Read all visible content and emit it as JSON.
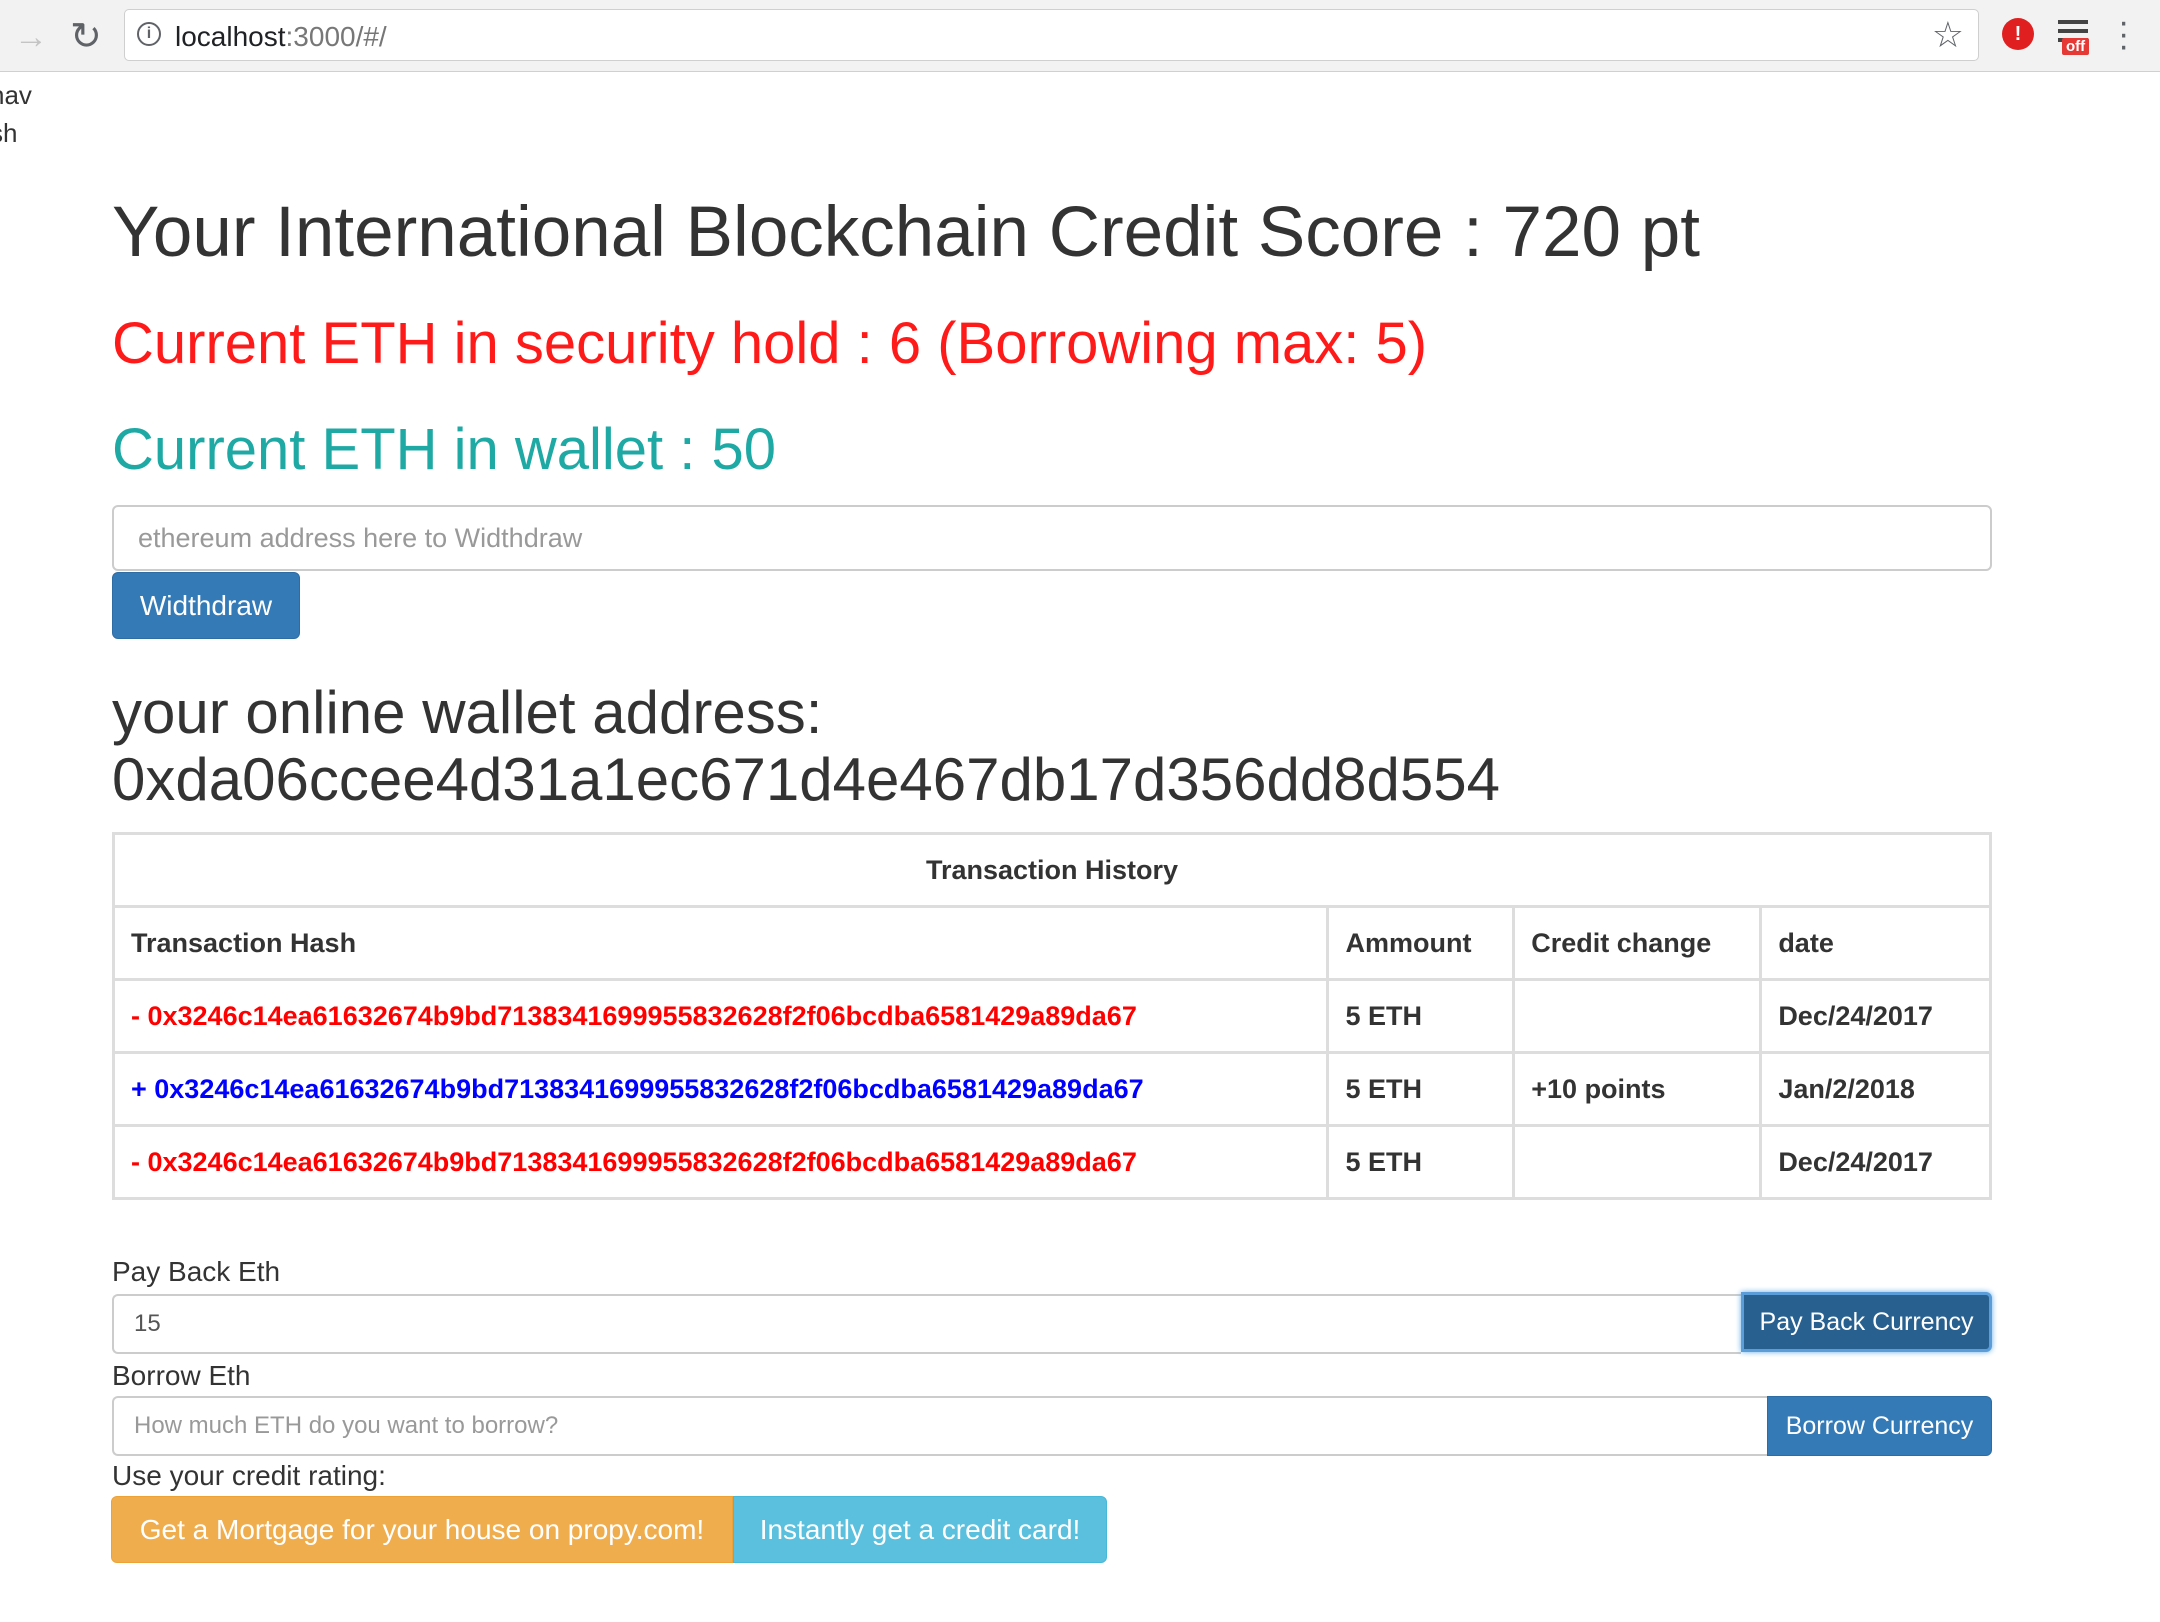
{
  "browser": {
    "url_host": "localhost",
    "url_rest": ":3000/#/",
    "extension_badge": "off"
  },
  "side_text": [
    "nav",
    "sh"
  ],
  "score_title": "Your International Blockchain Credit Score : 720 pt",
  "security_hold": "Current ETH in security hold : 6 (Borrowing max: 5)",
  "wallet_balance": "Current ETH in wallet : 50",
  "withdraw": {
    "placeholder": "ethereum address here to Widthdraw",
    "button_label": "Widthdraw"
  },
  "address_label": "your online wallet address:",
  "address_value": "0xda06ccee4d31a1ec671d4e467db17d356dd8d554",
  "transactions": {
    "caption": "Transaction History",
    "headers": [
      "Transaction Hash",
      "Ammount",
      "Credit change",
      "date"
    ],
    "rows": [
      {
        "hash": "- 0x3246c14ea61632674b9bd7138341699955832628f2f06bcdba6581429a89da67",
        "amount": "5 ETH",
        "credit": "",
        "date": "Dec/24/2017",
        "sign": "neg"
      },
      {
        "hash": "+ 0x3246c14ea61632674b9bd7138341699955832628f2f06bcdba6581429a89da67",
        "amount": "5 ETH",
        "credit": "+10 points",
        "date": "Jan/2/2018",
        "sign": "pos"
      },
      {
        "hash": "- 0x3246c14ea61632674b9bd7138341699955832628f2f06bcdba6581429a89da67",
        "amount": "5 ETH",
        "credit": "",
        "date": "Dec/24/2017",
        "sign": "neg"
      }
    ]
  },
  "pay_back": {
    "label": "Pay Back Eth",
    "value": "15",
    "button_label": "Pay Back Currency"
  },
  "borrow": {
    "label": "Borrow Eth",
    "placeholder": "How much ETH do you want to borrow?",
    "button_label": "Borrow Currency"
  },
  "credit_use": {
    "label": "Use your credit rating:",
    "mortgage_button": "Get a Mortgage for your house on propy.com!",
    "card_button": "Instantly get a credit card!"
  },
  "colors": {
    "hold": "#ff1a1a",
    "wallet": "#1fa9a5",
    "primary": "#337ab7",
    "warning": "#f0ad4e",
    "info": "#5bc0de"
  }
}
